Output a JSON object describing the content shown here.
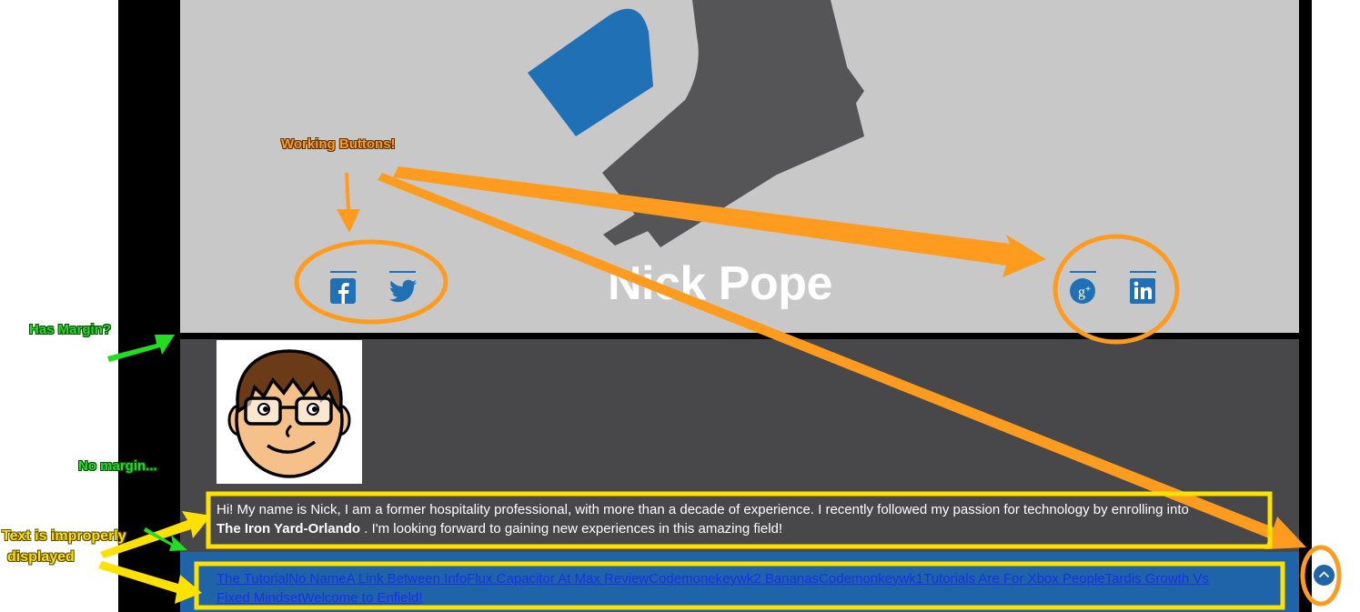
{
  "hero": {
    "name": "Nick Pope",
    "social_left": [
      {
        "name": "facebook",
        "icon": "facebook-icon"
      },
      {
        "name": "twitter",
        "icon": "twitter-icon"
      }
    ],
    "social_right": [
      {
        "name": "google-plus",
        "icon": "google-plus-icon"
      },
      {
        "name": "linkedin",
        "icon": "linkedin-icon"
      }
    ]
  },
  "about": {
    "avatar_icon": "cartoon-avatar",
    "bio_part1": "Hi! My name is Nick, I am a former hospitality professional, with more than a decade of experience. I recently followed my passion for technology by enrolling into",
    "bio_bold": "The Iron Yard-Orlando",
    "bio_part2": ". I'm looking forward to gaining new experiences in this amazing field!"
  },
  "post_links": [
    "The Tutorial",
    "No Name",
    "A Link Between Info",
    "Flux Capacitor At Max Review",
    "Codemonekeywk2 Bananas",
    "Codemonkeywk1",
    "Tutorials Are For Xbox People",
    "Tardis Growth Vs Fixed Mindset",
    "Welcome to Enfield!"
  ],
  "to_top_icon": "chevron-up-circle-icon",
  "annotations": {
    "working_buttons": "Working Buttons!",
    "has_margin": "Has Margin?",
    "no_margin": "No margin...",
    "text_improper_line1": "Text is improperly",
    "text_improper_line2": "displayed"
  },
  "colors": {
    "brand_blue": "#1f70b5",
    "hero_gray": "#c8c8c8",
    "about_dark": "#48474a",
    "annotation_orange": "#ff9b1f",
    "annotation_green": "#22dd22",
    "annotation_yellow": "#ffe100"
  }
}
